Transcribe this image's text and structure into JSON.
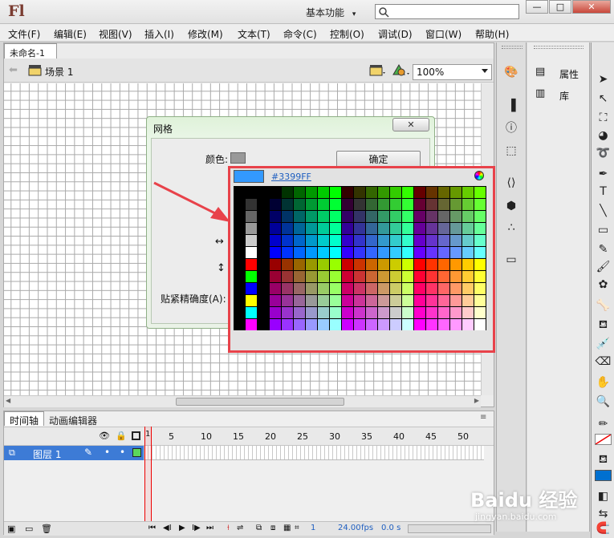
{
  "app": {
    "logo": "Fl",
    "workspace": "基本功能",
    "workspace_arrow": "▾"
  },
  "window_buttons": [
    "—",
    "□",
    "✕"
  ],
  "menu": [
    "文件(F)",
    "编辑(E)",
    "视图(V)",
    "插入(I)",
    "修改(M)",
    "文本(T)",
    "命令(C)",
    "控制(O)",
    "调试(D)",
    "窗口(W)",
    "帮助(H)"
  ],
  "document": {
    "tab": "未命名-1",
    "close": "✕",
    "scene": "场景 1",
    "zoom": "100%"
  },
  "panels": {
    "properties": "属性",
    "library": "库"
  },
  "grid_dialog": {
    "title": "网格",
    "color_label": "颜色:",
    "ok_button": "确定",
    "snap_label": "贴紧精确度(A):",
    "close": "✕"
  },
  "color_picker": {
    "hex": "#3399FF",
    "current_color": "#3399FF",
    "highlight_color": "#e8424a"
  },
  "timeline": {
    "tab_timeline": "时间轴",
    "tab_motion": "动画编辑器",
    "layer_name": "图层 1",
    "frame_numbers": [
      "1",
      "5",
      "10",
      "15",
      "20",
      "25",
      "30",
      "35",
      "40",
      "45",
      "50"
    ],
    "frame": "1",
    "fps": "24.00",
    "fps_unit": "fps",
    "time": "0.0 s"
  },
  "watermark": {
    "brand": "Baidu 经验",
    "url": "jingyan.baidu.com"
  },
  "colors": {
    "accent_blue": "#3d7bd6",
    "fill_color": "#0070d0"
  }
}
